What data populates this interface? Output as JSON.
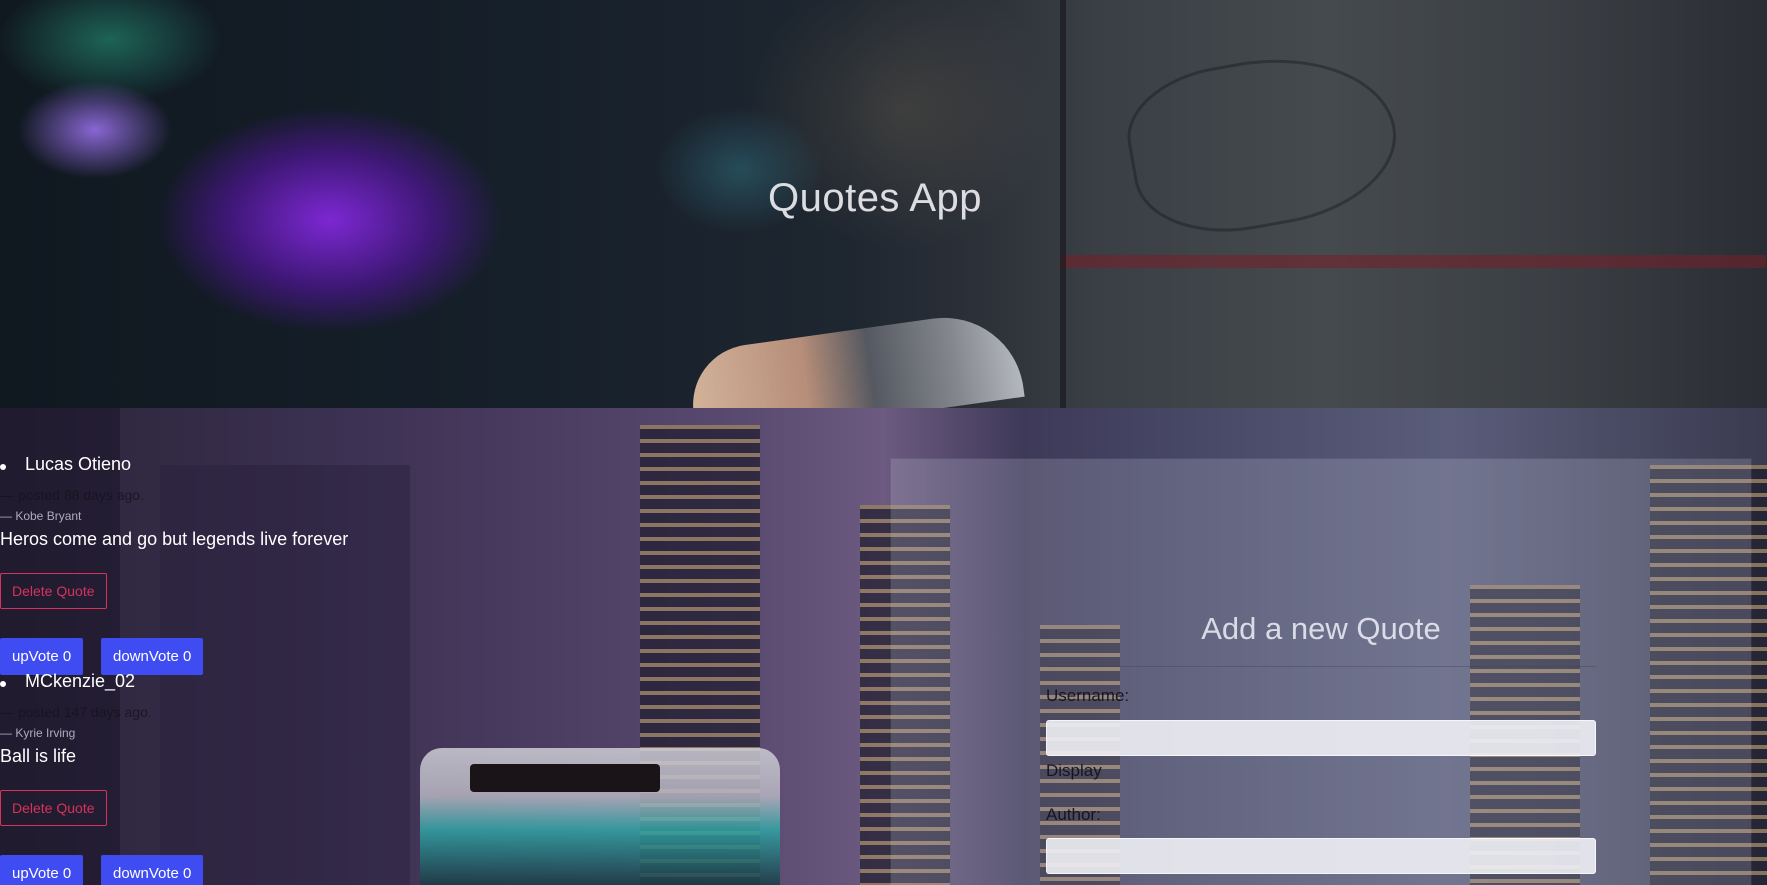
{
  "app": {
    "title": "Quotes App"
  },
  "quotes": [
    {
      "username": "Lucas Otieno",
      "posted": "— posted 88 days ago.",
      "author": "— Kobe Bryant",
      "text": "Heros come and go but legends live forever",
      "delete_label": "Delete Quote",
      "upvote_label": "upVote 0",
      "downvote_label": "downVote 0"
    },
    {
      "username": "MCkenzie_02",
      "posted": "— posted 147 days ago.",
      "author": "— Kyrie Irving",
      "text": "Ball is life",
      "delete_label": "Delete Quote",
      "upvote_label": "upVote 0",
      "downvote_label": "downVote 0"
    }
  ],
  "form": {
    "title": "Add a new Quote",
    "username_label": "Username:",
    "display_label": "Display",
    "author_label": "Author:",
    "username_value": "",
    "author_value": ""
  },
  "colors": {
    "vote_button": "#3f4cf2",
    "delete_button": "#d6335b"
  }
}
